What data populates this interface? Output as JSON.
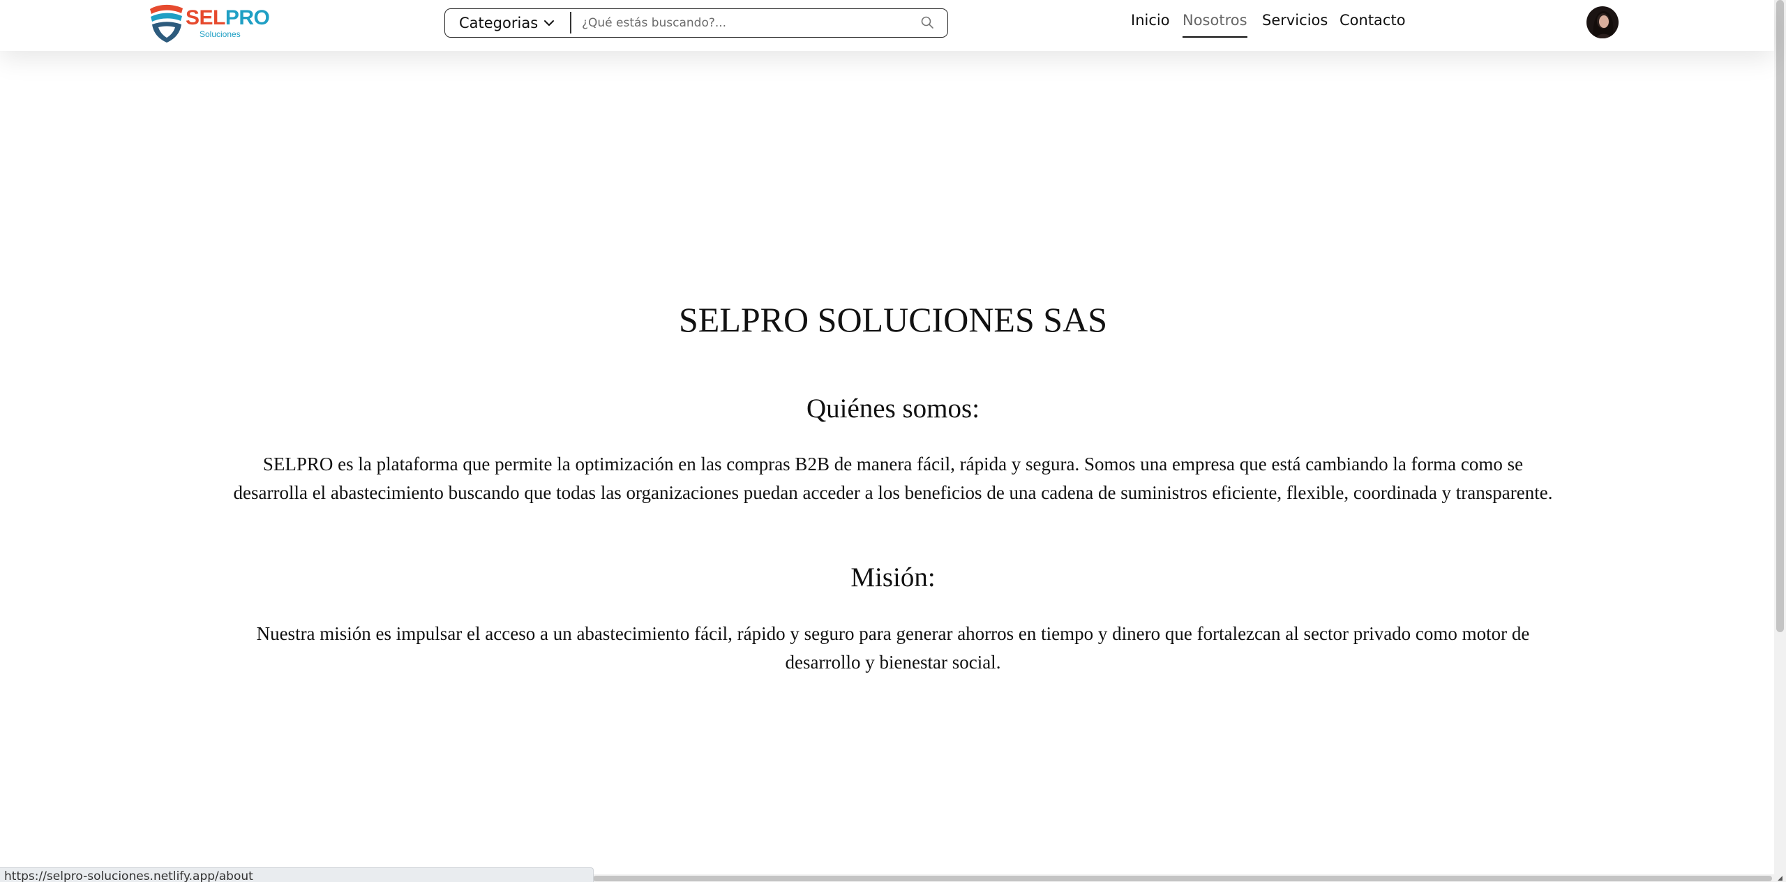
{
  "brand": {
    "name_part1": "SEL",
    "name_part2": "PRO",
    "tagline": "Soluciones",
    "colors": {
      "primary_red": "#e64a2e",
      "primary_blue": "#1f9fc4",
      "dark_blue": "#2d5b7d"
    }
  },
  "search": {
    "category_label": "Categorias",
    "placeholder": "¿Qué estás buscando?...",
    "value": ""
  },
  "nav": {
    "items": [
      {
        "label": "Inicio",
        "active": false
      },
      {
        "label": "Nosotros",
        "active": true
      },
      {
        "label": "Servicios",
        "active": false
      },
      {
        "label": "Contacto",
        "active": false
      }
    ]
  },
  "icons": {
    "category": "chevron-down-icon",
    "search": "search-icon",
    "avatar": "user-avatar"
  },
  "main": {
    "title": "SELPRO SOLUCIONES SAS",
    "about_heading": "Quiénes somos:",
    "about_text": "SELPRO es la plataforma que permite la optimización en las compras B2B de manera fácil, rápida y segura. Somos una empresa que está cambiando la forma como se desarrolla el abastecimiento buscando que todas las organizaciones puedan acceder a los beneficios de una cadena de suministros eficiente, flexible, coordinada y transparente.",
    "mission_heading": "Misión:",
    "mission_text": "Nuestra misión es impulsar el acceso a un abastecimiento fácil, rápido y seguro para generar ahorros en tiempo y dinero que fortalezcan al sector privado como motor de desarrollo y bienestar social."
  },
  "status_bar": {
    "url": "https://selpro-soluciones.netlify.app/about"
  }
}
